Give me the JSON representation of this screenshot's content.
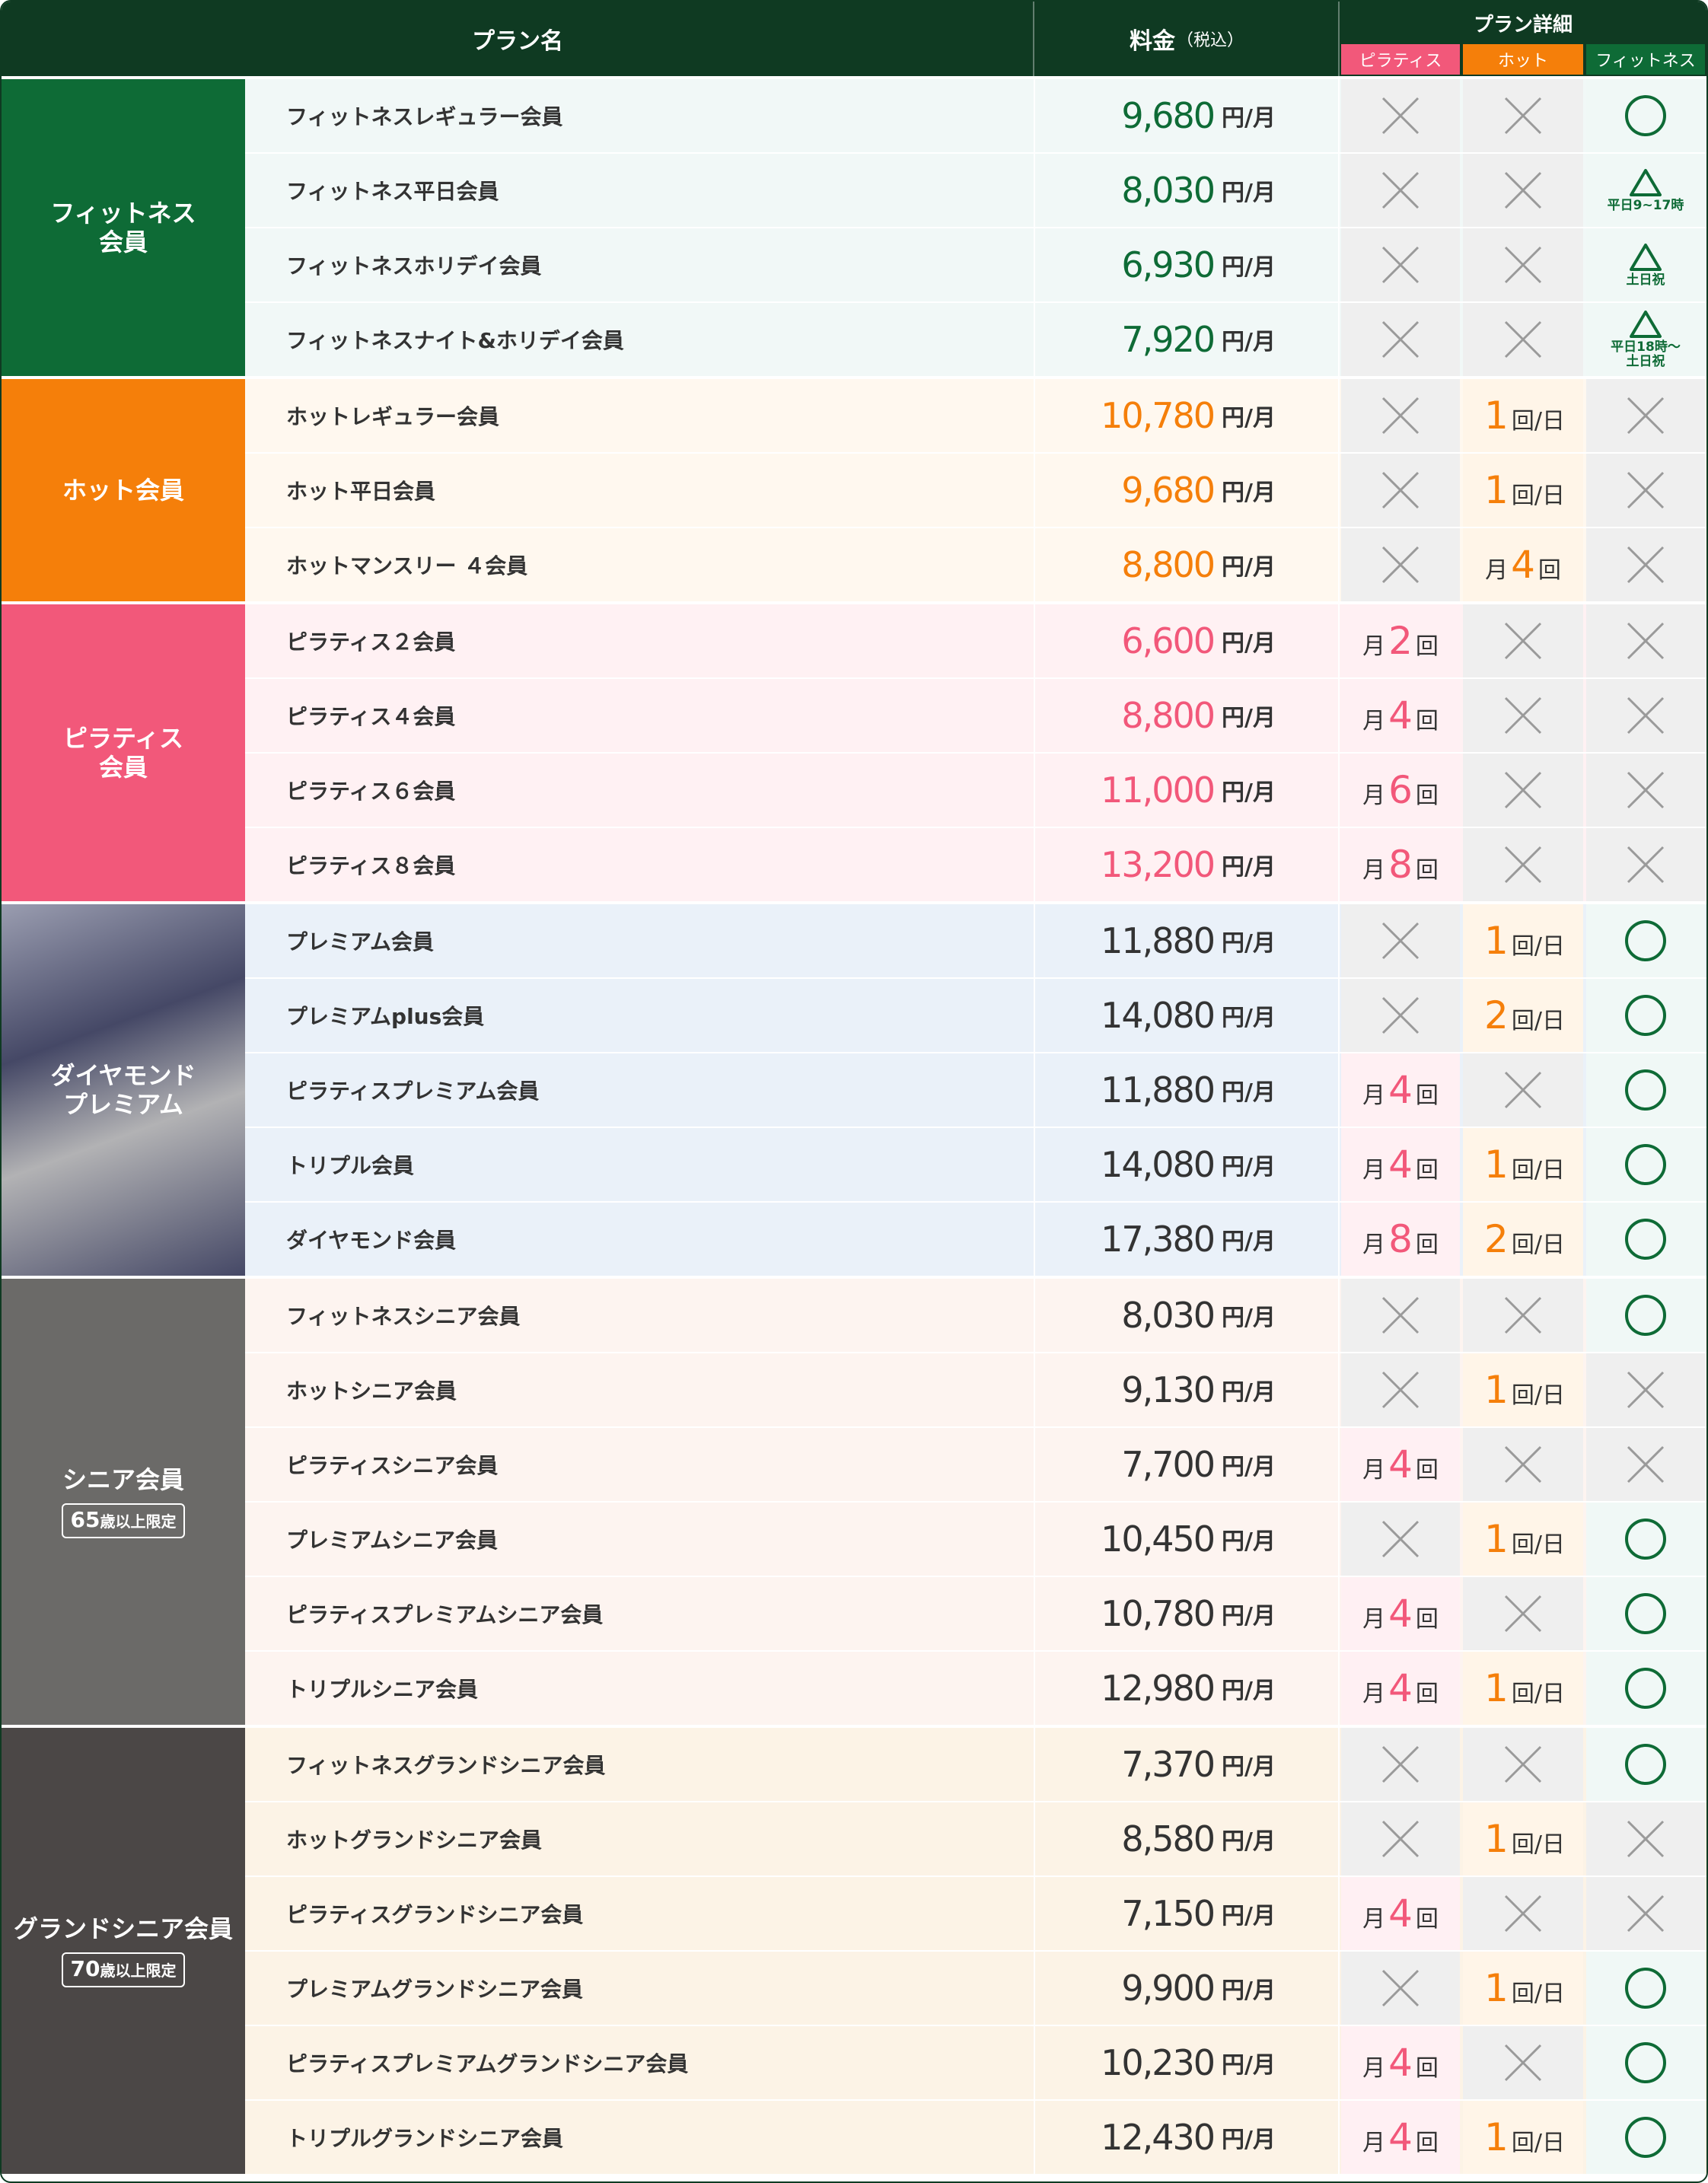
{
  "header": {
    "plan_name": "プラン名",
    "price": "料金",
    "price_note": "（税込）",
    "detail": "プラン詳細",
    "sub_pilates": "ピラティス",
    "sub_hot": "ホット",
    "sub_fitness": "フィットネス"
  },
  "colors": {
    "header_bg": "#0f3a22",
    "fitness": "#0e6b36",
    "hot": "#f57f0a",
    "pilates": "#f2587a",
    "diamond": "#5a5a6e",
    "senior": "#6b6a68",
    "grand_senior": "#4b4746",
    "cross": "#9a9a9a"
  },
  "unit_price": "円/月",
  "unit_month": "月",
  "unit_times": "回",
  "unit_per_day": "回/日",
  "groups": [
    {
      "id": "fitness",
      "label": "フィットネス\n会員",
      "note_num": "",
      "note_text": "",
      "bg": "#0e6b36",
      "gradient": false,
      "row_bg": "#f1f8f7",
      "price_color": "#0e6b36",
      "rows": [
        {
          "name": "フィットネスレギュラー会員",
          "price": "9,680",
          "pilates": {
            "type": "x"
          },
          "hot": {
            "type": "x"
          },
          "fitness": {
            "type": "o"
          }
        },
        {
          "name": "フィットネス平日会員",
          "price": "8,030",
          "pilates": {
            "type": "x"
          },
          "hot": {
            "type": "x"
          },
          "fitness": {
            "type": "tri",
            "note": "平日9~17時"
          }
        },
        {
          "name": "フィットネスホリデイ会員",
          "price": "6,930",
          "pilates": {
            "type": "x"
          },
          "hot": {
            "type": "x"
          },
          "fitness": {
            "type": "tri",
            "note": "土日祝"
          }
        },
        {
          "name": "フィットネスナイト&ホリデイ会員",
          "price": "7,920",
          "pilates": {
            "type": "x"
          },
          "hot": {
            "type": "x"
          },
          "fitness": {
            "type": "tri",
            "note": "平日18時～\n土日祝"
          }
        }
      ]
    },
    {
      "id": "hot",
      "label": "ホット会員",
      "note_num": "",
      "note_text": "",
      "bg": "#f57f0a",
      "gradient": false,
      "row_bg": "#fff8ef",
      "price_color": "#f57f0a",
      "rows": [
        {
          "name": "ホットレギュラー会員",
          "price": "10,780",
          "pilates": {
            "type": "x"
          },
          "hot": {
            "type": "day",
            "n": "1"
          },
          "fitness": {
            "type": "x"
          }
        },
        {
          "name": "ホット平日会員",
          "price": "9,680",
          "pilates": {
            "type": "x"
          },
          "hot": {
            "type": "day",
            "n": "1"
          },
          "fitness": {
            "type": "x"
          }
        },
        {
          "name": "ホットマンスリー ４会員",
          "price": "8,800",
          "pilates": {
            "type": "x"
          },
          "hot": {
            "type": "month",
            "n": "4"
          },
          "fitness": {
            "type": "x"
          }
        }
      ]
    },
    {
      "id": "pilates",
      "label": "ピラティス\n会員",
      "note_num": "",
      "note_text": "",
      "bg": "#f2587a",
      "gradient": false,
      "row_bg": "#fff1f3",
      "price_color": "#f2587a",
      "rows": [
        {
          "name": "ピラティス２会員",
          "price": "6,600",
          "pilates": {
            "type": "month",
            "n": "2"
          },
          "hot": {
            "type": "x"
          },
          "fitness": {
            "type": "x"
          }
        },
        {
          "name": "ピラティス４会員",
          "price": "8,800",
          "pilates": {
            "type": "month",
            "n": "4"
          },
          "hot": {
            "type": "x"
          },
          "fitness": {
            "type": "x"
          }
        },
        {
          "name": "ピラティス６会員",
          "price": "11,000",
          "pilates": {
            "type": "month",
            "n": "6"
          },
          "hot": {
            "type": "x"
          },
          "fitness": {
            "type": "x"
          }
        },
        {
          "name": "ピラティス８会員",
          "price": "13,200",
          "pilates": {
            "type": "month",
            "n": "8"
          },
          "hot": {
            "type": "x"
          },
          "fitness": {
            "type": "x"
          }
        }
      ]
    },
    {
      "id": "diamond",
      "label": "ダイヤモンド\nプレミアム",
      "note_num": "",
      "note_text": "",
      "bg": "#5a5a6e",
      "gradient": true,
      "row_bg": "#eaf1f9",
      "price_color": "#333333",
      "rows": [
        {
          "name": "プレミアム会員",
          "price": "11,880",
          "pilates": {
            "type": "x"
          },
          "hot": {
            "type": "day",
            "n": "1"
          },
          "fitness": {
            "type": "o"
          }
        },
        {
          "name": "プレミアムplus会員",
          "price": "14,080",
          "pilates": {
            "type": "x"
          },
          "hot": {
            "type": "day",
            "n": "2"
          },
          "fitness": {
            "type": "o"
          }
        },
        {
          "name": "ピラティスプレミアム会員",
          "price": "11,880",
          "pilates": {
            "type": "month",
            "n": "4"
          },
          "hot": {
            "type": "x"
          },
          "fitness": {
            "type": "o"
          }
        },
        {
          "name": "トリプル会員",
          "price": "14,080",
          "pilates": {
            "type": "month",
            "n": "4"
          },
          "hot": {
            "type": "day",
            "n": "1"
          },
          "fitness": {
            "type": "o"
          }
        },
        {
          "name": "ダイヤモンド会員",
          "price": "17,380",
          "pilates": {
            "type": "month",
            "n": "8"
          },
          "hot": {
            "type": "day",
            "n": "2"
          },
          "fitness": {
            "type": "o"
          }
        }
      ]
    },
    {
      "id": "senior",
      "label": "シニア会員",
      "note_num": "65",
      "note_text": "歳以上限定",
      "bg": "#6b6a68",
      "gradient": false,
      "row_bg": "#fdf4f0",
      "price_color": "#333333",
      "rows": [
        {
          "name": "フィットネスシニア会員",
          "price": "8,030",
          "pilates": {
            "type": "x"
          },
          "hot": {
            "type": "x"
          },
          "fitness": {
            "type": "o"
          }
        },
        {
          "name": "ホットシニア会員",
          "price": "9,130",
          "pilates": {
            "type": "x"
          },
          "hot": {
            "type": "day",
            "n": "1"
          },
          "fitness": {
            "type": "x"
          }
        },
        {
          "name": "ピラティスシニア会員",
          "price": "7,700",
          "pilates": {
            "type": "month",
            "n": "4"
          },
          "hot": {
            "type": "x"
          },
          "fitness": {
            "type": "x"
          }
        },
        {
          "name": "プレミアムシニア会員",
          "price": "10,450",
          "pilates": {
            "type": "x"
          },
          "hot": {
            "type": "day",
            "n": "1"
          },
          "fitness": {
            "type": "o"
          }
        },
        {
          "name": "ピラティスプレミアムシニア会員",
          "price": "10,780",
          "pilates": {
            "type": "month",
            "n": "4"
          },
          "hot": {
            "type": "x"
          },
          "fitness": {
            "type": "o"
          }
        },
        {
          "name": "トリプルシニア会員",
          "price": "12,980",
          "pilates": {
            "type": "month",
            "n": "4"
          },
          "hot": {
            "type": "day",
            "n": "1"
          },
          "fitness": {
            "type": "o"
          }
        }
      ]
    },
    {
      "id": "grand_senior",
      "label": "グランドシニア会員",
      "note_num": "70",
      "note_text": "歳以上限定",
      "bg": "#4b4746",
      "gradient": false,
      "row_bg": "#fcf3e6",
      "price_color": "#333333",
      "rows": [
        {
          "name": "フィットネスグランドシニア会員",
          "price": "7,370",
          "pilates": {
            "type": "x"
          },
          "hot": {
            "type": "x"
          },
          "fitness": {
            "type": "o"
          }
        },
        {
          "name": "ホットグランドシニア会員",
          "price": "8,580",
          "pilates": {
            "type": "x"
          },
          "hot": {
            "type": "day",
            "n": "1"
          },
          "fitness": {
            "type": "x"
          }
        },
        {
          "name": "ピラティスグランドシニア会員",
          "price": "7,150",
          "pilates": {
            "type": "month",
            "n": "4"
          },
          "hot": {
            "type": "x"
          },
          "fitness": {
            "type": "x"
          }
        },
        {
          "name": "プレミアムグランドシニア会員",
          "price": "9,900",
          "pilates": {
            "type": "x"
          },
          "hot": {
            "type": "day",
            "n": "1"
          },
          "fitness": {
            "type": "o"
          }
        },
        {
          "name": "ピラティスプレミアムグランドシニア会員",
          "price": "10,230",
          "pilates": {
            "type": "month",
            "n": "4"
          },
          "hot": {
            "type": "x"
          },
          "fitness": {
            "type": "o"
          }
        },
        {
          "name": "トリプルグランドシニア会員",
          "price": "12,430",
          "pilates": {
            "type": "month",
            "n": "4"
          },
          "hot": {
            "type": "day",
            "n": "1"
          },
          "fitness": {
            "type": "o"
          }
        }
      ]
    }
  ]
}
